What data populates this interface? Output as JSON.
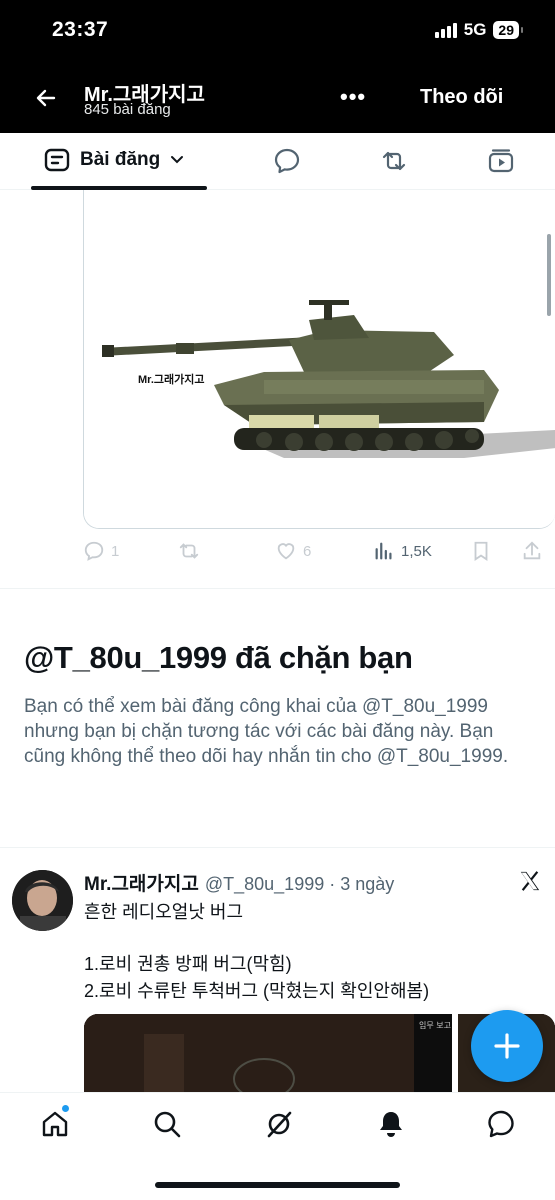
{
  "status_bar": {
    "time": "23:37",
    "network": "5G",
    "battery": "29"
  },
  "header": {
    "profile_name": "Mr.그래가지고",
    "post_count": "845 bài đăng",
    "follow_label": "Theo dõi",
    "more_label": "•••"
  },
  "tabs": {
    "active_label": "Bài đăng",
    "items": [
      "posts-filter",
      "replies",
      "reposts",
      "media"
    ]
  },
  "media_post": {
    "watermark": "Mr.그래가지고",
    "actions": {
      "replies": "1",
      "reposts": "",
      "likes": "6",
      "views": "1,5K"
    }
  },
  "blocked": {
    "title": "@T_80u_1999 đã chặn bạn",
    "body": "Bạn có thể xem bài đăng công khai của @T_80u_1999 nhưng bạn bị chặn tương tác với các bài đăng này. Bạn cũng không thể theo dõi hay nhắn tin cho @T_80u_1999."
  },
  "tweet": {
    "name": "Mr.그래가지고",
    "handle_time": "@T_80u_1999 · 3 ngày",
    "line1": "흔한 레디오얼낫 버그",
    "line2": "1.로비 권총 방패 버그(막힘)",
    "line3": "2.로비 수류탄 투척버그 (막혔는지 확인안해봄)",
    "media_label": "임무 보고"
  },
  "bottom_nav": [
    "home-icon",
    "search-icon",
    "grok-icon",
    "notifications-icon",
    "messages-icon"
  ],
  "colors": {
    "accent": "#1d9bf0",
    "text": "#0f1419",
    "secondary": "#536471",
    "header_bg": "#000000"
  }
}
